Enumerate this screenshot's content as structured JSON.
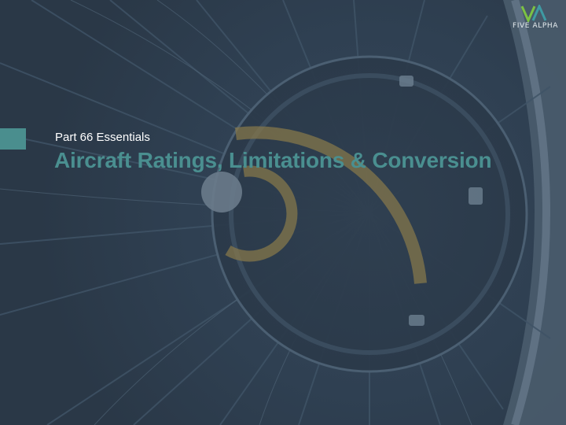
{
  "slide": {
    "subtitle": "Part 66 Essentials",
    "title": "Aircraft Ratings, Limitations & Conversion"
  },
  "logo": {
    "text": "FIVE ALPHA",
    "colors": {
      "left_stroke": "#7cc243",
      "right_stroke": "#3e9aa3"
    }
  },
  "colors": {
    "background": "#2e3d4c",
    "accent": "#4a8e8e",
    "title": "#4a8f90",
    "subtitle": "#ffffff",
    "arc": "#8a7a4a"
  }
}
